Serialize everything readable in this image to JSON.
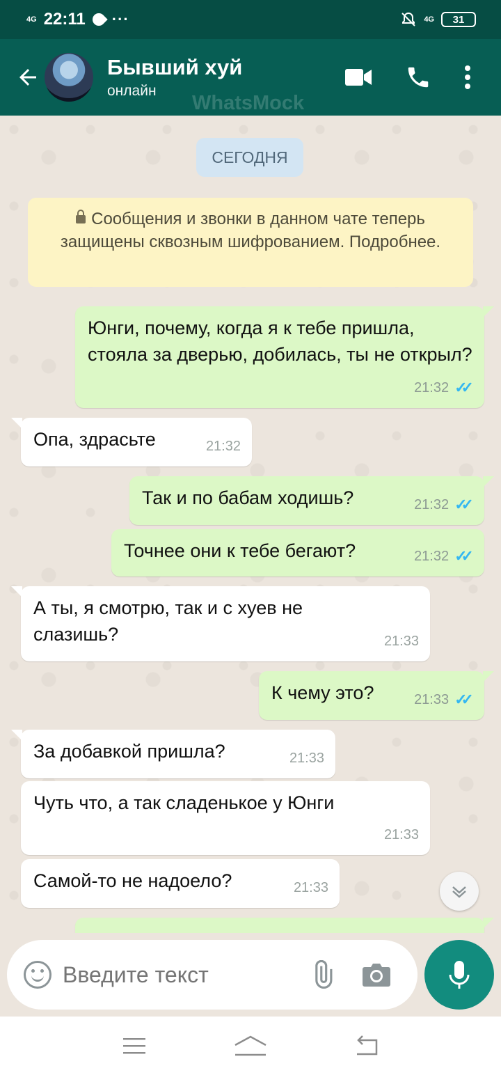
{
  "status_bar": {
    "network_left": "4G",
    "time": "22:11",
    "more": "···",
    "network_right": "4G",
    "battery": "31"
  },
  "header": {
    "contact_name": "Бывший хуй",
    "contact_status": "онлайн",
    "watermark": "WhatsMock"
  },
  "chat": {
    "date_chip": "СЕГОДНЯ",
    "encryption_notice": "Сообщения и звонки в данном чате теперь защищены сквозным шифрованием. Подробнее.",
    "messages": [
      {
        "direction": "out",
        "text": "Юнги, почему, когда я к тебе пришла, стояла за дверью, добилась, ты не открыл?",
        "time": "21:32",
        "ticks": "✓✓"
      },
      {
        "direction": "in",
        "text": "Опа, здрасьте",
        "time": "21:32"
      },
      {
        "direction": "out",
        "text": "Так и по бабам ходишь?",
        "time": "21:32",
        "ticks": "✓✓"
      },
      {
        "direction": "out",
        "text": "Точнее они к тебе бегают?",
        "time": "21:32",
        "ticks": "✓✓"
      },
      {
        "direction": "in",
        "text": "А ты, я смотрю, так и с хуев не слазишь?",
        "time": "21:33"
      },
      {
        "direction": "out",
        "text": "К чему это?",
        "time": "21:33",
        "ticks": "✓✓"
      },
      {
        "direction": "in",
        "text": "За добавкой пришла?",
        "time": "21:33"
      },
      {
        "direction": "in",
        "text": "Чуть что, а так сладенькое у Юнги",
        "time": "21:33"
      },
      {
        "direction": "in",
        "text": "Самой-то не надоело?",
        "time": "21:33"
      }
    ]
  },
  "input": {
    "placeholder": "Введите текст"
  },
  "colors": {
    "status_bar": "#064d44",
    "header": "#075e54",
    "outgoing_bubble": "#dcf8c6",
    "incoming_bubble": "#ffffff",
    "chat_background": "#ece5dd",
    "read_ticks": "#34b7f1",
    "mic_button": "#128c7e"
  },
  "icons": [
    "back-arrow-icon",
    "video-call-icon",
    "phone-icon",
    "more-vert-icon",
    "emoji-icon",
    "attach-icon",
    "camera-icon",
    "mic-icon",
    "scroll-down-icon",
    "menu-icon",
    "home-icon",
    "back-icon"
  ]
}
